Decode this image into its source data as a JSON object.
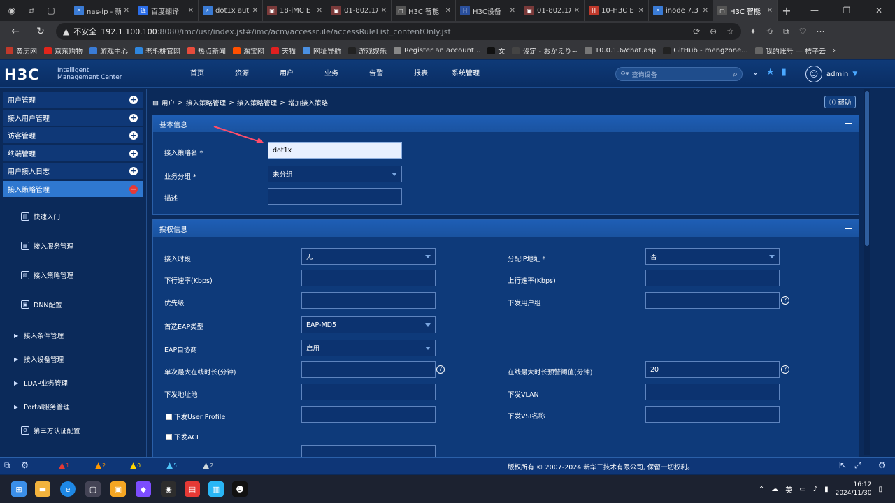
{
  "browser": {
    "tabs": [
      {
        "title": "nas-ip - 新",
        "color": "#3a7bd5",
        "glyph": "⌕"
      },
      {
        "title": "百度翻译",
        "color": "#2b6de8",
        "glyph": "译"
      },
      {
        "title": "dot1x aut",
        "color": "#3a7bd5",
        "glyph": "⌕"
      },
      {
        "title": "18-iMC E",
        "color": "#7a3a3a",
        "glyph": "▣"
      },
      {
        "title": "01-802.1X",
        "color": "#7a3a3a",
        "glyph": "▣"
      },
      {
        "title": "H3C 智能",
        "color": "#555",
        "glyph": "▢"
      },
      {
        "title": "H3C设备",
        "color": "#2a4f9c",
        "glyph": "H"
      },
      {
        "title": "01-802.1X",
        "color": "#7a3a3a",
        "glyph": "▣"
      },
      {
        "title": "10-H3C E",
        "color": "#c0392b",
        "glyph": "H"
      },
      {
        "title": "inode 7.3",
        "color": "#3a7bd5",
        "glyph": "⌕"
      },
      {
        "title": "H3C 智能",
        "color": "#555",
        "glyph": "▢"
      }
    ],
    "insecure_label": "不安全",
    "url_host": "192.1.100.100",
    "url_rest": ":8080/imc/usr/index.jsf#/imc/acm/accessrule/accessRuleList_contentOnly.jsf",
    "bookmarks": [
      {
        "label": "黄历网",
        "color": "#c0392b"
      },
      {
        "label": "京东购物",
        "color": "#e1251b"
      },
      {
        "label": "游戏中心",
        "color": "#3a7bd5"
      },
      {
        "label": "老毛桃官网",
        "color": "#2e86de"
      },
      {
        "label": "热点新闻",
        "color": "#e74c3c"
      },
      {
        "label": "淘宝网",
        "color": "#ff5000"
      },
      {
        "label": "天猫",
        "color": "#e02020"
      },
      {
        "label": "网址导航",
        "color": "#4a90e2"
      },
      {
        "label": "游戏娱乐",
        "color": "#222"
      },
      {
        "label": "Register an account...",
        "color": "#888"
      },
      {
        "label": "文",
        "color": "#111"
      },
      {
        "label": "设定 - おかえり~",
        "color": "#444"
      },
      {
        "label": "10.0.1.6/chat.asp",
        "color": "#777"
      },
      {
        "label": "GitHub - mengzone...",
        "color": "#222"
      },
      {
        "label": "我的账号 — 桔子云",
        "color": "#666"
      }
    ]
  },
  "header": {
    "logo": "H3C",
    "logo_sub1": "Intelligent",
    "logo_sub2": "Management Center",
    "nav": [
      "首页",
      "资源",
      "用户",
      "业务",
      "告警",
      "报表",
      "系统管理"
    ],
    "search_placeholder": "查询设备",
    "username": "admin"
  },
  "sidebar": {
    "items": [
      "用户管理",
      "接入用户管理",
      "访客管理",
      "终端管理",
      "用户接入日志",
      "接入策略管理"
    ],
    "subs": [
      "快速入门",
      "接入服务管理",
      "接入策略管理",
      "DNN配置"
    ],
    "groups": [
      "接入条件管理",
      "接入设备管理",
      "LDAP业务管理",
      "Portal服务管理"
    ],
    "third": "第三方认证配置"
  },
  "content": {
    "breadcrumb": [
      "用户",
      "接入策略管理",
      "接入策略管理",
      "增加接入策略"
    ],
    "help": "帮助",
    "basic": {
      "title": "基本信息",
      "name_label": "接入策略名",
      "name_value": "dot1x",
      "group_label": "业务分组",
      "group_value": "未分组",
      "desc_label": "描述"
    },
    "auth": {
      "title": "授权信息",
      "access_time_label": "接入时段",
      "access_time_value": "无",
      "assign_ip_label": "分配IP地址",
      "assign_ip_value": "否",
      "down_rate_label": "下行速率(Kbps)",
      "up_rate_label": "上行速率(Kbps)",
      "priority_label": "优先级",
      "user_group_label": "下发用户组",
      "eap_type_label": "首选EAP类型",
      "eap_type_value": "EAP-MD5",
      "eap_nego_label": "EAP自协商",
      "eap_nego_value": "启用",
      "max_online_label": "单次最大在线时长(分钟)",
      "warn_label": "在线最大时长预警阈值(分钟)",
      "warn_value": "20",
      "pool_label": "下发地址池",
      "vlan_label": "下发VLAN",
      "profile_label": "下发User Profile",
      "vsi_label": "下发VSI名称",
      "acl_label": "下发ACL"
    }
  },
  "statusbar": {
    "alarms": [
      {
        "count": "1",
        "color": "#e53935"
      },
      {
        "count": "2",
        "color": "#ff9800"
      },
      {
        "count": "0",
        "color": "#ffd600"
      },
      {
        "count": "5",
        "color": "#4fc3f7"
      },
      {
        "count": "2",
        "color": "#cfd8dc"
      }
    ],
    "copyright": "版权所有 © 2007-2024 新华三技术有限公司, 保留一切权利。"
  },
  "taskbar": {
    "ime": "英",
    "time": "16:12",
    "date": "2024/11/30"
  }
}
